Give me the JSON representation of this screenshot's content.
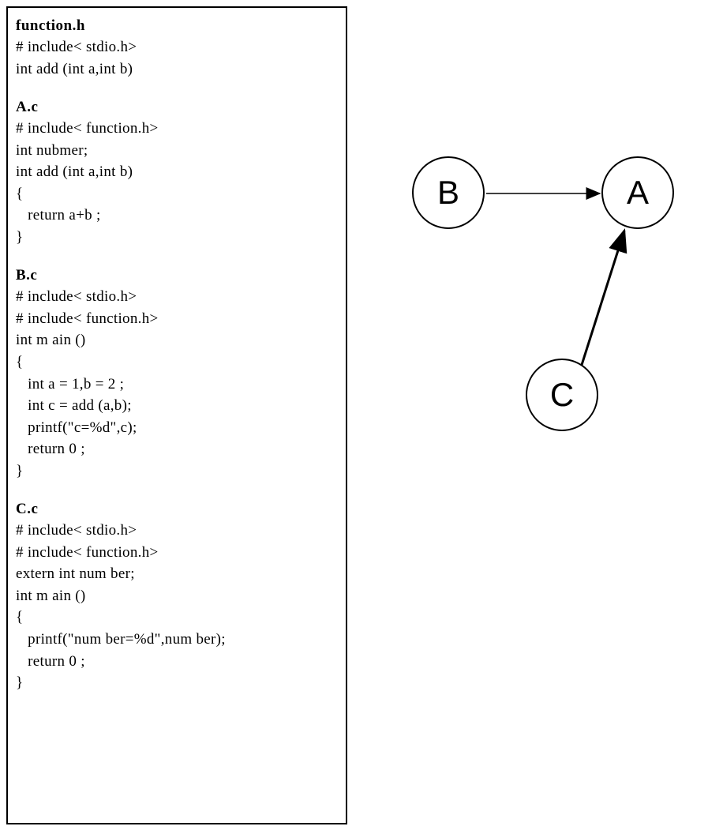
{
  "files": {
    "functionh": {
      "title": "function.h",
      "lines": [
        "# include< stdio.h>",
        "int add (int a,int b)"
      ]
    },
    "ac": {
      "title": "A.c",
      "lines": [
        "# include< function.h>",
        "int nubmer;",
        "int add (int a,int b)",
        "{",
        "   return a+b ;",
        "}"
      ]
    },
    "bc": {
      "title": "B.c",
      "lines": [
        "# include< stdio.h>",
        "# include< function.h>",
        "int m ain ()",
        "{",
        "   int a = 1,b = 2 ;",
        "   int c = add (a,b);",
        "   printf(\"c=%d\",c);",
        "   return 0 ;",
        "}"
      ]
    },
    "cc": {
      "title": "C.c",
      "lines": [
        "# include< stdio.h>",
        "# include< function.h>",
        "extern int num ber;",
        "int m ain ()",
        "{",
        "   printf(\"num ber=%d\",num ber);",
        "   return 0 ;",
        "}"
      ]
    }
  },
  "graph": {
    "nodes": {
      "A": "A",
      "B": "B",
      "C": "C"
    },
    "edges": [
      {
        "from": "B",
        "to": "A"
      },
      {
        "from": "C",
        "to": "A"
      }
    ]
  }
}
